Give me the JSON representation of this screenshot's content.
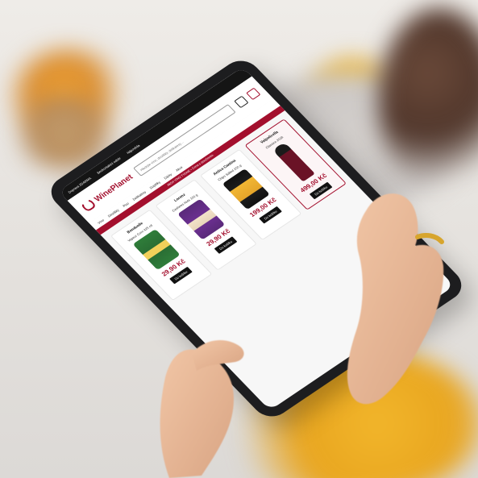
{
  "tablet_ui": {
    "topbar": {
      "left": "Doprava ZDARMA",
      "middle": "Bezkontaktní odběr",
      "right": "Nápověda"
    },
    "logo": {
      "text": "WinePlanet"
    },
    "search": {
      "placeholder": "Hledejte víno, destiláty, delikatesy…"
    },
    "nav": [
      "Víno",
      "Destiláty",
      "Pivo",
      "Delikatesy",
      "Doplňky",
      "Dárky",
      "Akce"
    ],
    "promo": "Akční VÍNO TÝDNE • Cena s doručením",
    "products": [
      {
        "brand": "Bonduelle",
        "name": "Vapeur Corn 425 ml",
        "price": "29,90 Kč",
        "cta": "Do košíku"
      },
      {
        "brand": "Lorenz",
        "name": "Cashews Nuts 100 g",
        "price": "29,90 Kč",
        "cta": "Do košíku"
      },
      {
        "brand": "Antica Cantina",
        "name": "Chips Salted 200 g",
        "price": "199,00 Kč",
        "cta": "Do košíku"
      },
      {
        "brand": "Valpolicella",
        "name": "Classico 2018",
        "price": "499,00 Kč",
        "cta": "Do košíku"
      }
    ]
  },
  "colors": {
    "brand_red": "#a30f2d",
    "topbar": "#151515",
    "sleeve_yellow": "#f2b62b"
  }
}
